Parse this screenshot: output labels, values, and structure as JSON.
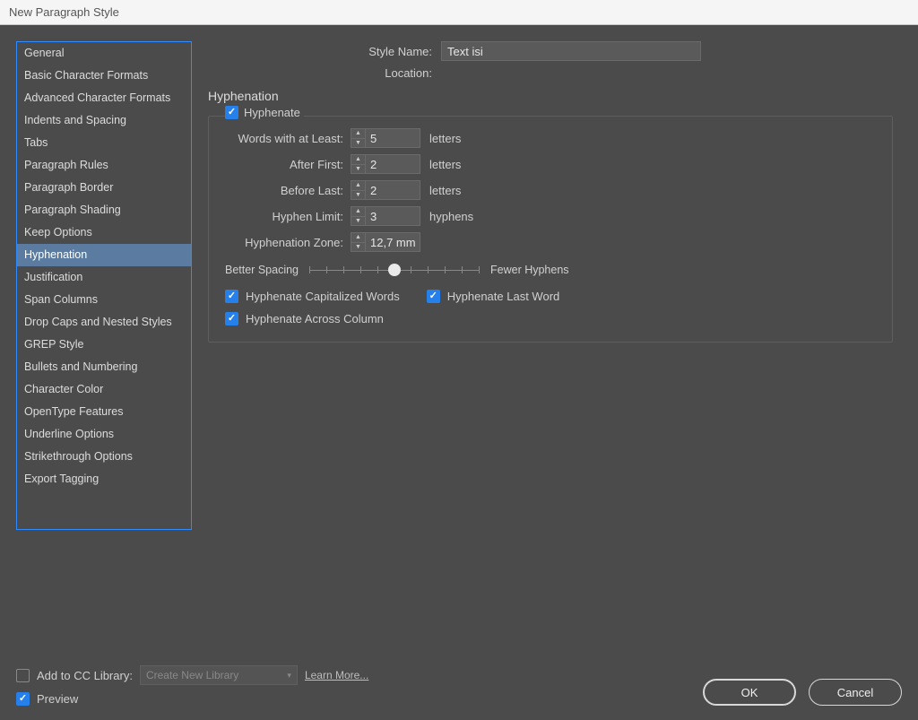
{
  "title": "New Paragraph Style",
  "sidebar": {
    "items": [
      {
        "label": "General"
      },
      {
        "label": "Basic Character Formats"
      },
      {
        "label": "Advanced Character Formats"
      },
      {
        "label": "Indents and Spacing"
      },
      {
        "label": "Tabs"
      },
      {
        "label": "Paragraph Rules"
      },
      {
        "label": "Paragraph Border"
      },
      {
        "label": "Paragraph Shading"
      },
      {
        "label": "Keep Options"
      },
      {
        "label": "Hyphenation"
      },
      {
        "label": "Justification"
      },
      {
        "label": "Span Columns"
      },
      {
        "label": "Drop Caps and Nested Styles"
      },
      {
        "label": "GREP Style"
      },
      {
        "label": "Bullets and Numbering"
      },
      {
        "label": "Character Color"
      },
      {
        "label": "OpenType Features"
      },
      {
        "label": "Underline Options"
      },
      {
        "label": "Strikethrough Options"
      },
      {
        "label": "Export Tagging"
      }
    ],
    "active_index": 9
  },
  "header": {
    "style_name_label": "Style Name:",
    "style_name_value": "Text isi",
    "location_label": "Location:"
  },
  "section": {
    "title": "Hyphenation",
    "hyphenate_checked": true,
    "hyphenate_label": "Hyphenate",
    "fields": {
      "words_at_least": {
        "label": "Words with at Least:",
        "value": "5",
        "unit": "letters"
      },
      "after_first": {
        "label": "After First:",
        "value": "2",
        "unit": "letters"
      },
      "before_last": {
        "label": "Before Last:",
        "value": "2",
        "unit": "letters"
      },
      "hyphen_limit": {
        "label": "Hyphen Limit:",
        "value": "3",
        "unit": "hyphens"
      },
      "hyphenation_zone": {
        "label": "Hyphenation Zone:",
        "value": "12,7 mm",
        "unit": ""
      }
    },
    "slider": {
      "left_label": "Better Spacing",
      "right_label": "Fewer Hyphens"
    },
    "options": {
      "capitalized": {
        "label": "Hyphenate Capitalized Words",
        "checked": true
      },
      "last_word": {
        "label": "Hyphenate Last Word",
        "checked": true
      },
      "across_column": {
        "label": "Hyphenate Across Column",
        "checked": true
      }
    }
  },
  "footer": {
    "add_library_label": "Add to CC Library:",
    "add_library_checked": false,
    "library_select_value": "Create New Library",
    "learn_more": "Learn More...",
    "preview_label": "Preview",
    "preview_checked": true,
    "ok": "OK",
    "cancel": "Cancel"
  }
}
